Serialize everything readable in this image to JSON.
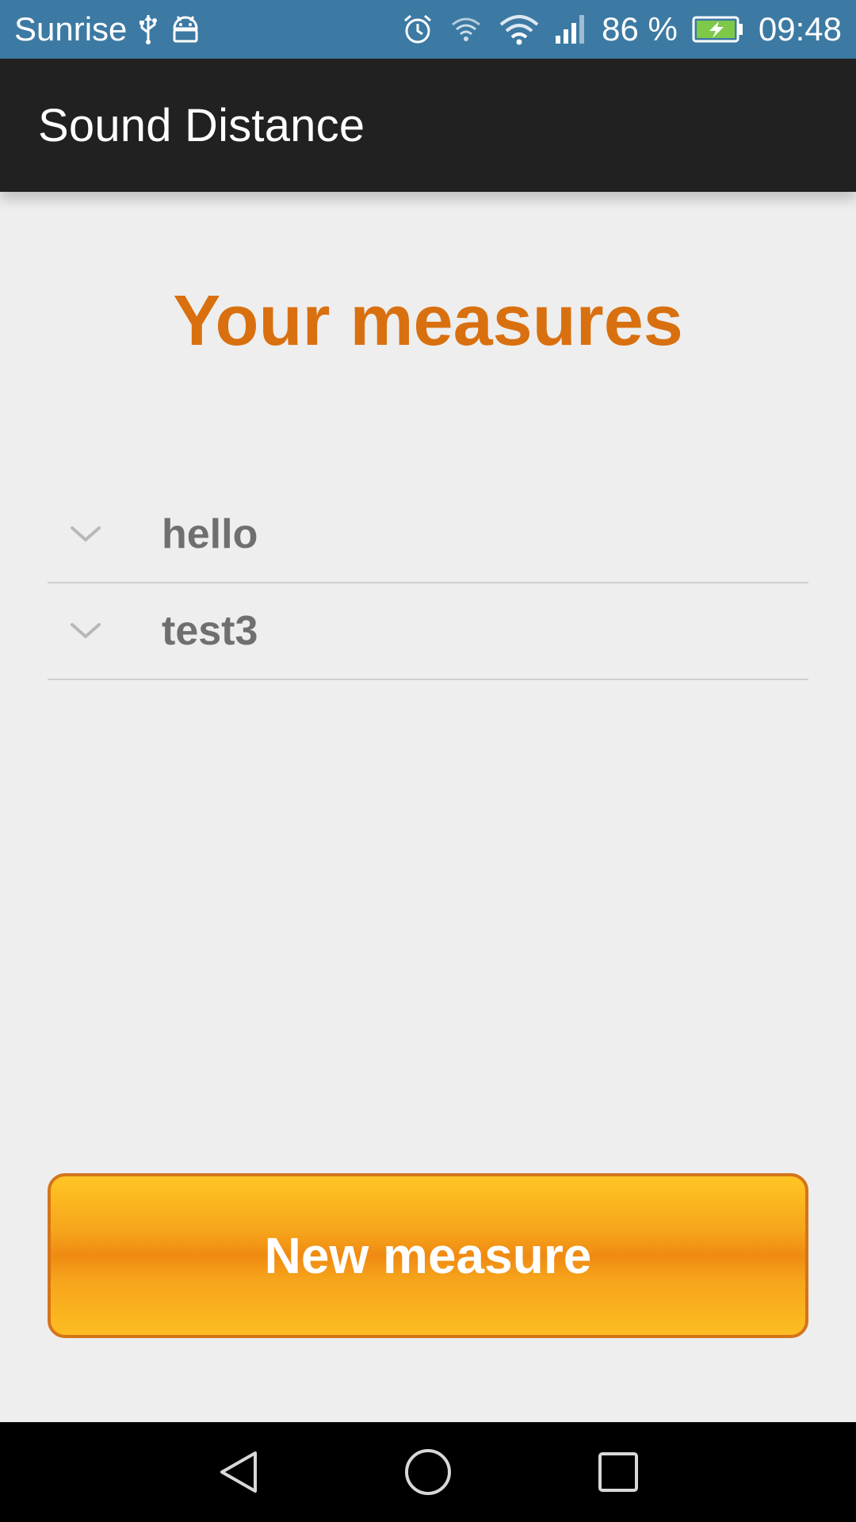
{
  "status_bar": {
    "carrier": "Sunrise",
    "battery_percent": "86 %",
    "time": "09:48",
    "icons": [
      "usb-icon",
      "android-debug-icon",
      "alarm-icon",
      "wifi-calling-icon",
      "wifi-icon",
      "signal-icon",
      "battery-charging-icon"
    ]
  },
  "app_bar": {
    "title": "Sound Distance"
  },
  "main": {
    "title": "Your measures",
    "measures": [
      {
        "label": "hello",
        "icon": "chevron-down-icon"
      },
      {
        "label": "test3",
        "icon": "chevron-down-icon"
      }
    ],
    "new_button_label": "New measure"
  },
  "nav_bar": {
    "icons": [
      "back-icon",
      "home-icon",
      "recents-icon"
    ]
  },
  "colors": {
    "status_bar": "#3c7aa3",
    "app_bar": "#212121",
    "background": "#eeeeee",
    "title_accent": "#d9700f",
    "button_orange": "#f6a41b",
    "button_border": "#d4741a",
    "item_text": "#6f6f6f",
    "nav_bar": "#000000"
  }
}
